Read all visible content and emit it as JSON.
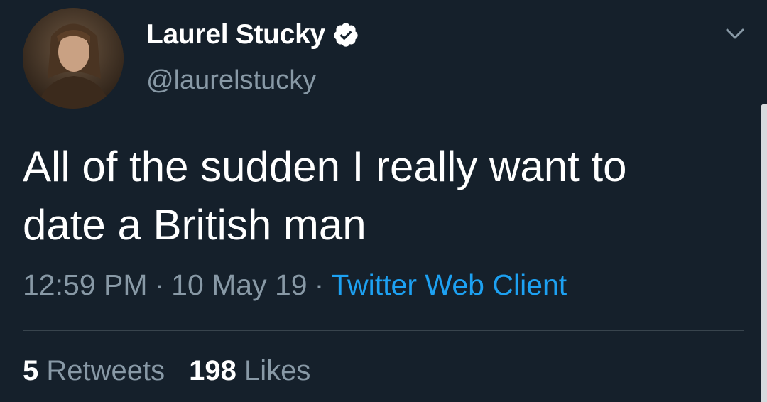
{
  "author": {
    "display_name": "Laurel Stucky",
    "handle": "@laurelstucky",
    "verified": true
  },
  "tweet": {
    "text_line1": "All of the sudden I really want to",
    "text_line2": "date a British man"
  },
  "meta": {
    "time": "12:59 PM",
    "separator": "·",
    "date": "10 May 19",
    "client": "Twitter Web Client"
  },
  "stats": {
    "retweets_count": "5",
    "retweets_label": "Retweets",
    "likes_count": "198",
    "likes_label": "Likes"
  },
  "colors": {
    "background": "#15202b",
    "secondary_text": "#8899a6",
    "link": "#1da1f2",
    "divider": "#38444d"
  },
  "icons": {
    "verified": "verified-badge-icon",
    "menu": "chevron-down-icon"
  }
}
